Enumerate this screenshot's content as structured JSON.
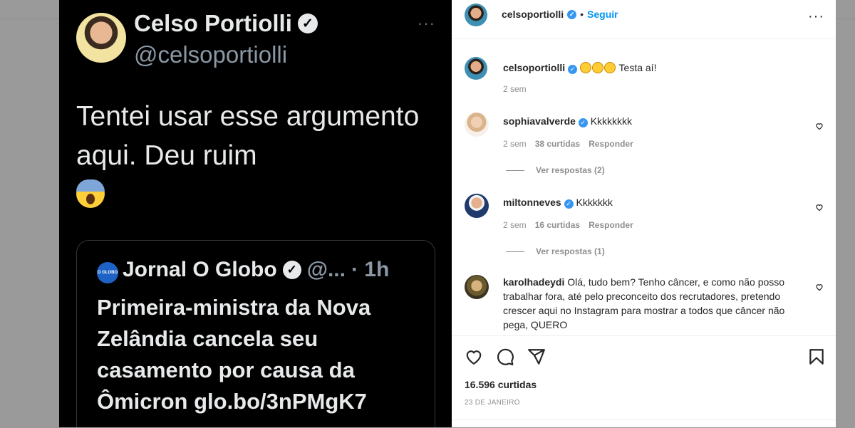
{
  "tweet": {
    "author_name": "Celso Portiolli",
    "handle": "@celsoportiolli",
    "more": "···",
    "text": "Tentei usar esse argumento aqui. Deu ruim",
    "quote": {
      "logo_text": "O GLOBO",
      "author": "Jornal O Globo",
      "handle": "@...",
      "time": "· 1h",
      "text": "Primeira-ministra da Nova Zelândia cancela seu casamento por causa da Ômicron glo.bo/3nPMgK7"
    }
  },
  "post": {
    "header": {
      "username": "celsoportiolli",
      "separator": "•",
      "follow_label": "Seguir",
      "more": "···"
    },
    "caption": {
      "username": "celsoportiolli",
      "text": "Testa aí!",
      "time": "2 sem"
    },
    "comments": [
      {
        "username": "sophiavalverde",
        "text": "Kkkkkkkk",
        "time": "2 sem",
        "likes": "38 curtidas",
        "reply_label": "Responder",
        "view_replies": "Ver respostas (2)"
      },
      {
        "username": "miltonneves",
        "text": "Kkkkkkk",
        "time": "2 sem",
        "likes": "16 curtidas",
        "reply_label": "Responder",
        "view_replies": "Ver respostas (1)"
      },
      {
        "username": "karolhadeydi",
        "text": "Olá, tudo bem? Tenho câncer, e como não posso trabalhar fora, até pelo preconceito dos recrutadores, pretendo crescer aqui no Instagram para mostrar a todos que câncer não pega, QUERO"
      }
    ],
    "likes_count": "16.596 curtidas",
    "date": "23 DE JANEIRO"
  },
  "colors": {
    "accent": "#0095f6",
    "verified": "#3797f0",
    "tweet_bg": "#000000"
  },
  "icons": [
    "verified-icon",
    "heart-icon",
    "comment-icon",
    "share-icon",
    "bookmark-icon",
    "more-icon",
    "scream-emoji-icon",
    "laughing-emoji-icon"
  ]
}
